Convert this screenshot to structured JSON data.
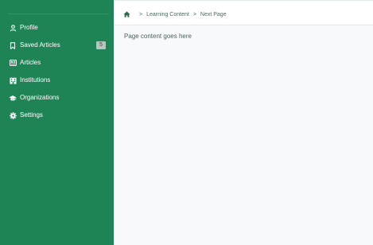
{
  "colors": {
    "sidebar_bg": "#1e8456",
    "page_bg": "#f7f9fb",
    "text_light": "#ffffff",
    "badge_bg": "#b9c6bf"
  },
  "sidebar": {
    "items": [
      {
        "label": "Profile",
        "icon": "user-icon"
      },
      {
        "label": "Saved Articles",
        "icon": "bookmark-icon",
        "badge": "5"
      },
      {
        "label": "Articles",
        "icon": "newspaper-icon"
      },
      {
        "label": "Institutions",
        "icon": "building-icon"
      },
      {
        "label": "Organizations",
        "icon": "graduation-cap-icon"
      },
      {
        "label": "Settings",
        "icon": "gear-icon"
      }
    ]
  },
  "breadcrumb": {
    "home_icon": "home-icon",
    "separator": ">",
    "items": [
      "Learning Content",
      "Next Page"
    ]
  },
  "main": {
    "content_text": "Page content goes here"
  }
}
